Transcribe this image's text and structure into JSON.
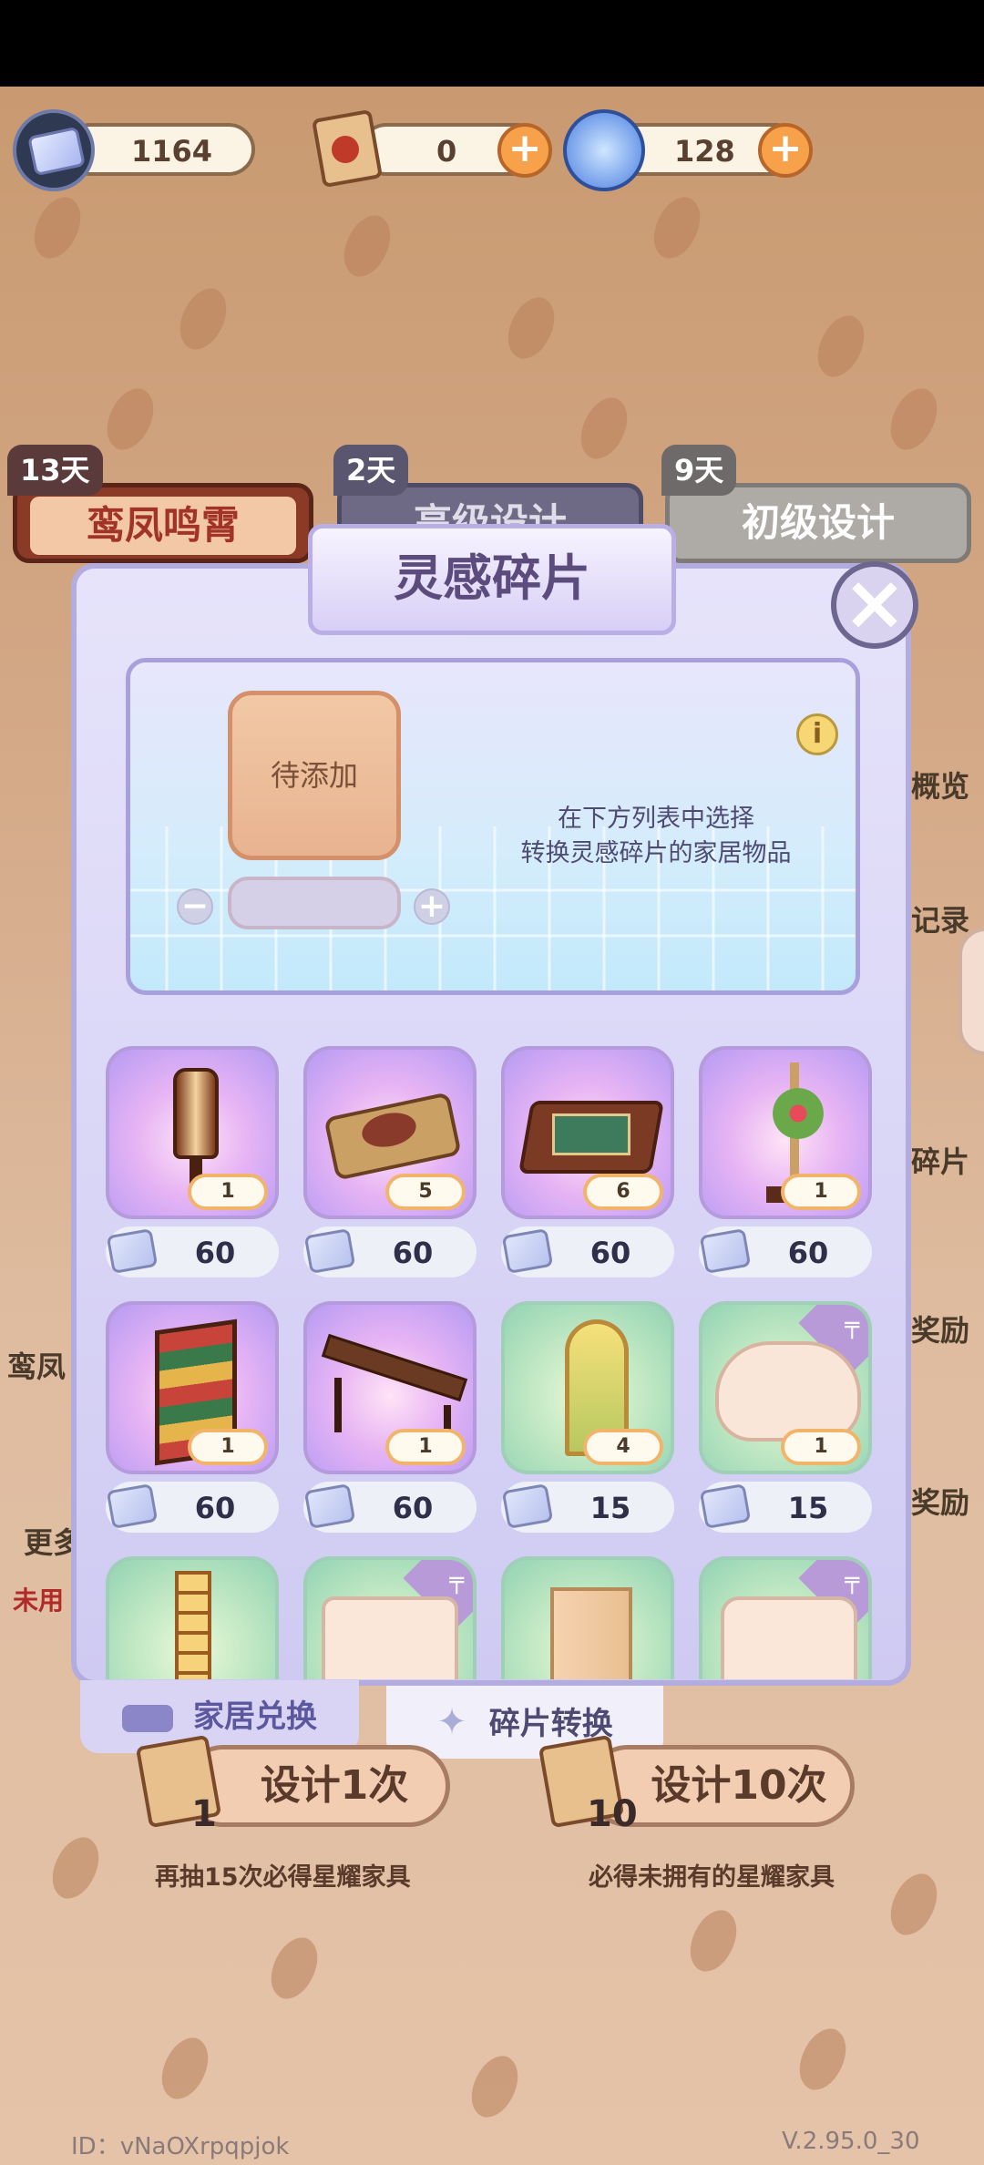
{
  "currencies": [
    {
      "name": "inspiration-fragment",
      "value": "1164"
    },
    {
      "name": "design-scroll",
      "value": "0"
    },
    {
      "name": "swirl-gem",
      "value": "128"
    }
  ],
  "banner_tabs": [
    {
      "days": "13天",
      "label": "鸾凤鸣霄"
    },
    {
      "days": "2天",
      "label": "高级设计"
    },
    {
      "days": "9天",
      "label": "初级设计"
    }
  ],
  "side_labels": [
    "概览",
    "记录",
    "碎片",
    "奖励",
    "奖励",
    "鸾凤",
    "更多",
    "未用"
  ],
  "modal": {
    "title": "灵感碎片",
    "slot_placeholder": "待添加",
    "hint_line1": "在下方列表中选择",
    "hint_line2": "转换灵感碎片的家居物品"
  },
  "items": [
    {
      "name": "lantern",
      "qty": "1",
      "price": "60",
      "style": "purple"
    },
    {
      "name": "food-platter",
      "qty": "5",
      "price": "60",
      "style": "purple"
    },
    {
      "name": "game-board",
      "qty": "6",
      "price": "60",
      "style": "purple"
    },
    {
      "name": "flower-stand",
      "qty": "1",
      "price": "60",
      "style": "purple"
    },
    {
      "name": "floral-screen",
      "qty": "1",
      "price": "60",
      "style": "purple"
    },
    {
      "name": "wooden-bench",
      "qty": "1",
      "price": "60",
      "style": "purple"
    },
    {
      "name": "arched-window",
      "qty": "4",
      "price": "15",
      "style": "green"
    },
    {
      "name": "cloud-sofa",
      "qty": "1",
      "price": "15",
      "style": "green"
    },
    {
      "name": "lattice-panel",
      "qty": "",
      "price": "",
      "style": "green"
    },
    {
      "name": "bathtub",
      "qty": "",
      "price": "",
      "style": "green"
    },
    {
      "name": "curtain-door",
      "qty": "",
      "price": "",
      "style": "green"
    },
    {
      "name": "sink-basin",
      "qty": "",
      "price": "",
      "style": "green"
    }
  ],
  "bottom_tabs": {
    "exchange": "家居兑换",
    "convert": "碎片转换"
  },
  "draw": {
    "single_label": "设计1次",
    "single_count": "1",
    "single_note": "再抽15次必得星耀家具",
    "ten_label": "设计10次",
    "ten_count": "10",
    "ten_note": "必得未拥有的星耀家具"
  },
  "footer": {
    "id": "ID：vNaOXrpqpjok",
    "version": "V.2.95.0_30"
  }
}
